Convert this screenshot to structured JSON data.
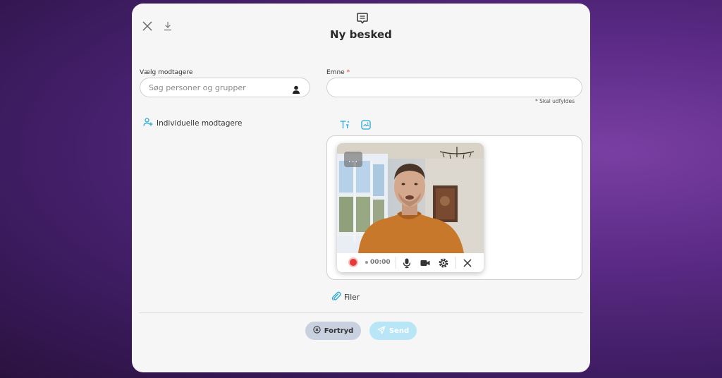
{
  "header": {
    "title": "Ny besked"
  },
  "form": {
    "recipients_label": "Vælg modtagere",
    "search_placeholder": "Søg personer og grupper",
    "subject_label": "Emne",
    "required_marker": "*",
    "subject_value": "",
    "required_hint": "* Skal udfyldes",
    "individual_recipients": "Individuelle modtagere"
  },
  "recorder": {
    "timer": "00:00",
    "more_label": "..."
  },
  "attachments": {
    "label": "Filer"
  },
  "actions": {
    "cancel_label": "Fortryd",
    "send_label": "Send"
  },
  "colors": {
    "accent": "#22a6d6",
    "record": "#e43a3a",
    "cancel_bg": "#c9d0e0",
    "send_bg": "#b8e6f6"
  },
  "icons": [
    "close-icon",
    "download-icon",
    "message-icon",
    "person-icon",
    "add-person-icon",
    "text-format-icon",
    "image-icon",
    "record-icon",
    "microphone-icon",
    "camera-icon",
    "settings-icon",
    "close-icon",
    "paperclip-icon",
    "cancel-circle-icon",
    "send-icon"
  ]
}
